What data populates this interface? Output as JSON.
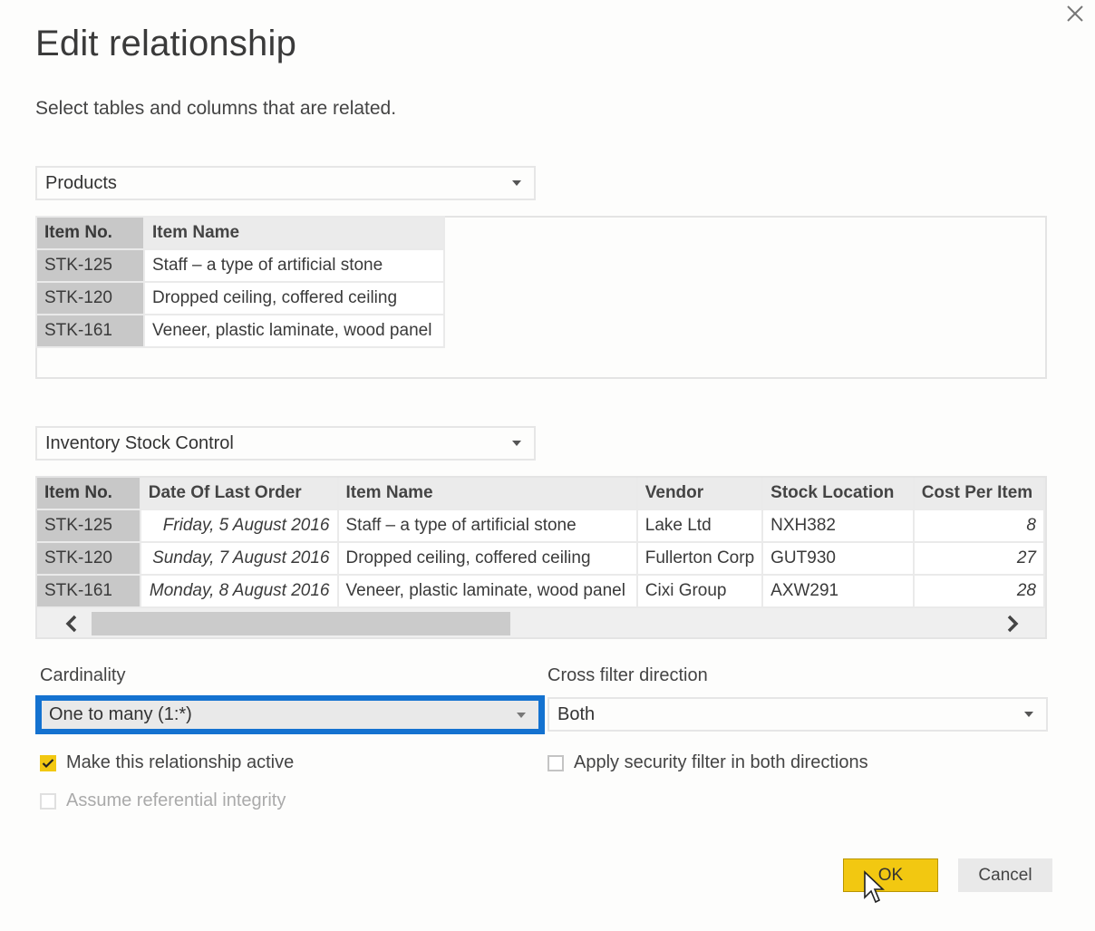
{
  "dialog": {
    "title": "Edit relationship",
    "subtitle": "Select tables and columns that are related.",
    "close_icon": "close-icon"
  },
  "table1": {
    "selected": "Products",
    "columns": [
      "Item No.",
      "Item Name"
    ],
    "rows": [
      [
        "STK-125",
        "Staff – a type of artificial stone"
      ],
      [
        "STK-120",
        "Dropped ceiling, coffered ceiling"
      ],
      [
        "STK-161",
        "Veneer, plastic laminate, wood panel"
      ]
    ]
  },
  "table2": {
    "selected": "Inventory Stock Control",
    "columns": [
      "Item No.",
      "Date Of Last Order",
      "Item Name",
      "Vendor",
      "Stock Location",
      "Cost Per Item"
    ],
    "rows": [
      [
        "STK-125",
        "Friday, 5 August 2016",
        "Staff – a type of artificial stone",
        "Lake Ltd",
        "NXH382",
        "8"
      ],
      [
        "STK-120",
        "Sunday, 7 August 2016",
        "Dropped ceiling, coffered ceiling",
        "Fullerton Corp",
        "GUT930",
        "27"
      ],
      [
        "STK-161",
        "Monday, 8 August 2016",
        "Veneer, plastic laminate, wood panel",
        "Cixi Group",
        "AXW291",
        "28"
      ]
    ],
    "scroll_left_icon": "chevron-left-icon",
    "scroll_right_icon": "chevron-right-icon"
  },
  "cardinality": {
    "label": "Cardinality",
    "value": "One to many (1:*)",
    "focus_color": "#1472d0"
  },
  "cross_filter": {
    "label": "Cross filter direction",
    "value": "Both"
  },
  "options": {
    "make_active": {
      "label": "Make this relationship active",
      "checked": true
    },
    "referential_integrity": {
      "label": "Assume referential integrity",
      "checked": false,
      "disabled": true
    },
    "security_filter": {
      "label": "Apply security filter in both directions",
      "checked": false
    }
  },
  "buttons": {
    "ok": "OK",
    "cancel": "Cancel",
    "ok_color": "#f2c811"
  }
}
